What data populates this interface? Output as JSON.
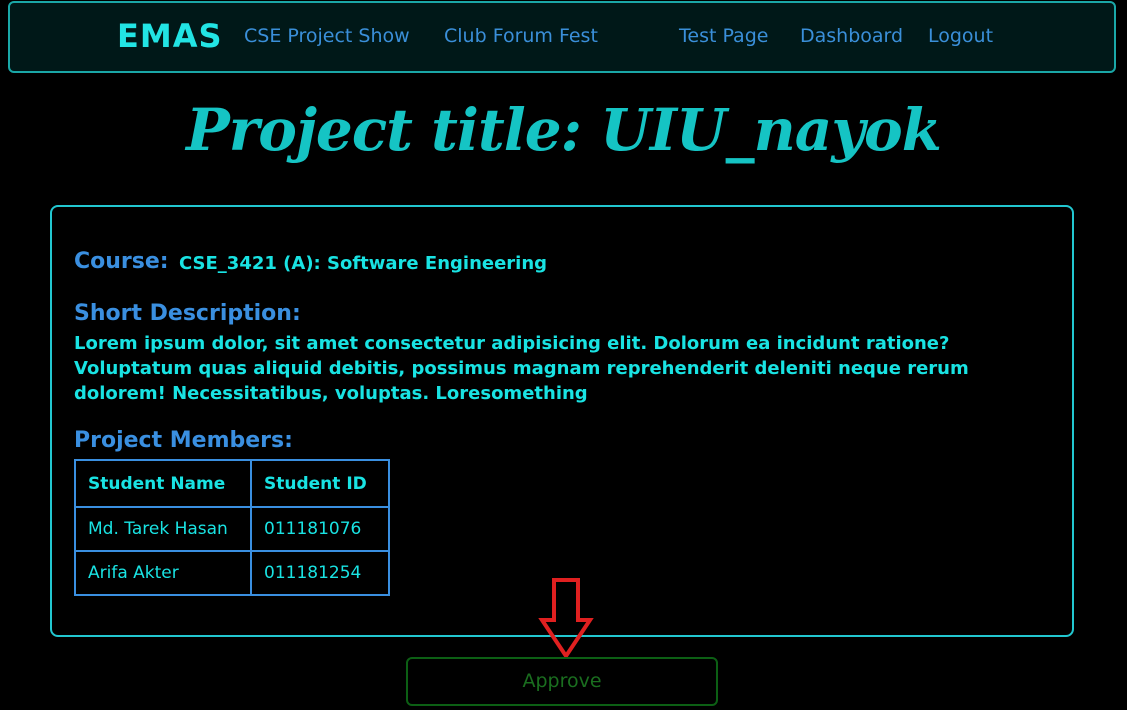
{
  "nav": {
    "brand": "EMAS",
    "links": [
      {
        "label": "CSE Project Show"
      },
      {
        "label": "Club Forum Fest"
      },
      {
        "label": "Test Page"
      },
      {
        "label": "Dashboard"
      },
      {
        "label": "Logout"
      }
    ]
  },
  "page": {
    "title": "Project title: UIU_nayok"
  },
  "card": {
    "course_label": "Course:",
    "course_value": "CSE_3421 (A): Software Engineering",
    "description_label": "Short Description:",
    "description_text": "Lorem ipsum dolor, sit amet consectetur adipisicing elit. Dolorum ea incidunt ratione? Voluptatum quas aliquid debitis, possimus magnam reprehenderit deleniti neque rerum dolorem! Necessitatibus, voluptas. Loresomething",
    "members_label": "Project Members:",
    "members_table": {
      "headers": [
        "Student Name",
        "Student ID"
      ],
      "rows": [
        [
          "Md. Tarek Hasan",
          "011181076"
        ],
        [
          "Arifa Akter",
          "011181254"
        ]
      ]
    }
  },
  "actions": {
    "approve_label": "Approve"
  },
  "colors": {
    "background": "#000000",
    "accent_cyan": "#19e3e3",
    "accent_blue": "#3a8fe0",
    "approve_green": "#1a6e1f",
    "arrow_red": "#e02020"
  },
  "icons": {
    "pointer": "down-arrow-icon"
  }
}
